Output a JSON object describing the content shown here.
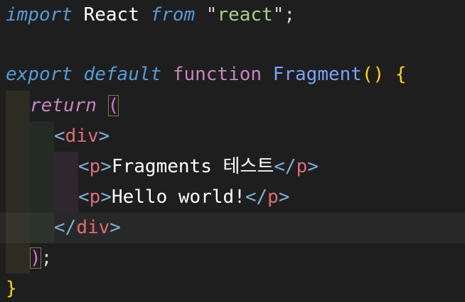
{
  "editor": {
    "language": "jsx",
    "theme": {
      "background": "#1e1e1e",
      "current_line": "#282828",
      "keyword": "#569cd6",
      "control": "#c586c0",
      "string": "#a6d189",
      "function_name": "#7aa2f7",
      "bracket_gold": "#ffd700",
      "bracket_pink": "#da70d6",
      "tag_name": "#e06c75",
      "tag_bracket": "#7fb2d6"
    },
    "lines": {
      "l1": {
        "import": "import",
        "react": "React",
        "from": "from",
        "q1": "\"",
        "module": "react",
        "q2": "\"",
        "semi": ";"
      },
      "l3": {
        "export": "export",
        "default": "default",
        "function": "function",
        "name": "Fragment",
        "open_paren": "(",
        "close_paren": ")",
        "open_brace": "{"
      },
      "l4": {
        "return": "return",
        "open_paren": "("
      },
      "l5": {
        "lt": "<",
        "tag": "div",
        "gt": ">"
      },
      "l6": {
        "lt1": "<",
        "tag1": "p",
        "gt1": ">",
        "text": "Fragments 테스트",
        "lt2": "</",
        "tag2": "p",
        "gt2": ">"
      },
      "l7": {
        "lt1": "<",
        "tag1": "p",
        "gt1": ">",
        "text": "Hello world!",
        "lt2": "</",
        "tag2": "p",
        "gt2": ">"
      },
      "l8": {
        "lt": "</",
        "tag": "div",
        "gt": ">"
      },
      "l9": {
        "close_paren": ")",
        "semi": ";"
      },
      "l10": {
        "close_brace": "}"
      }
    }
  }
}
